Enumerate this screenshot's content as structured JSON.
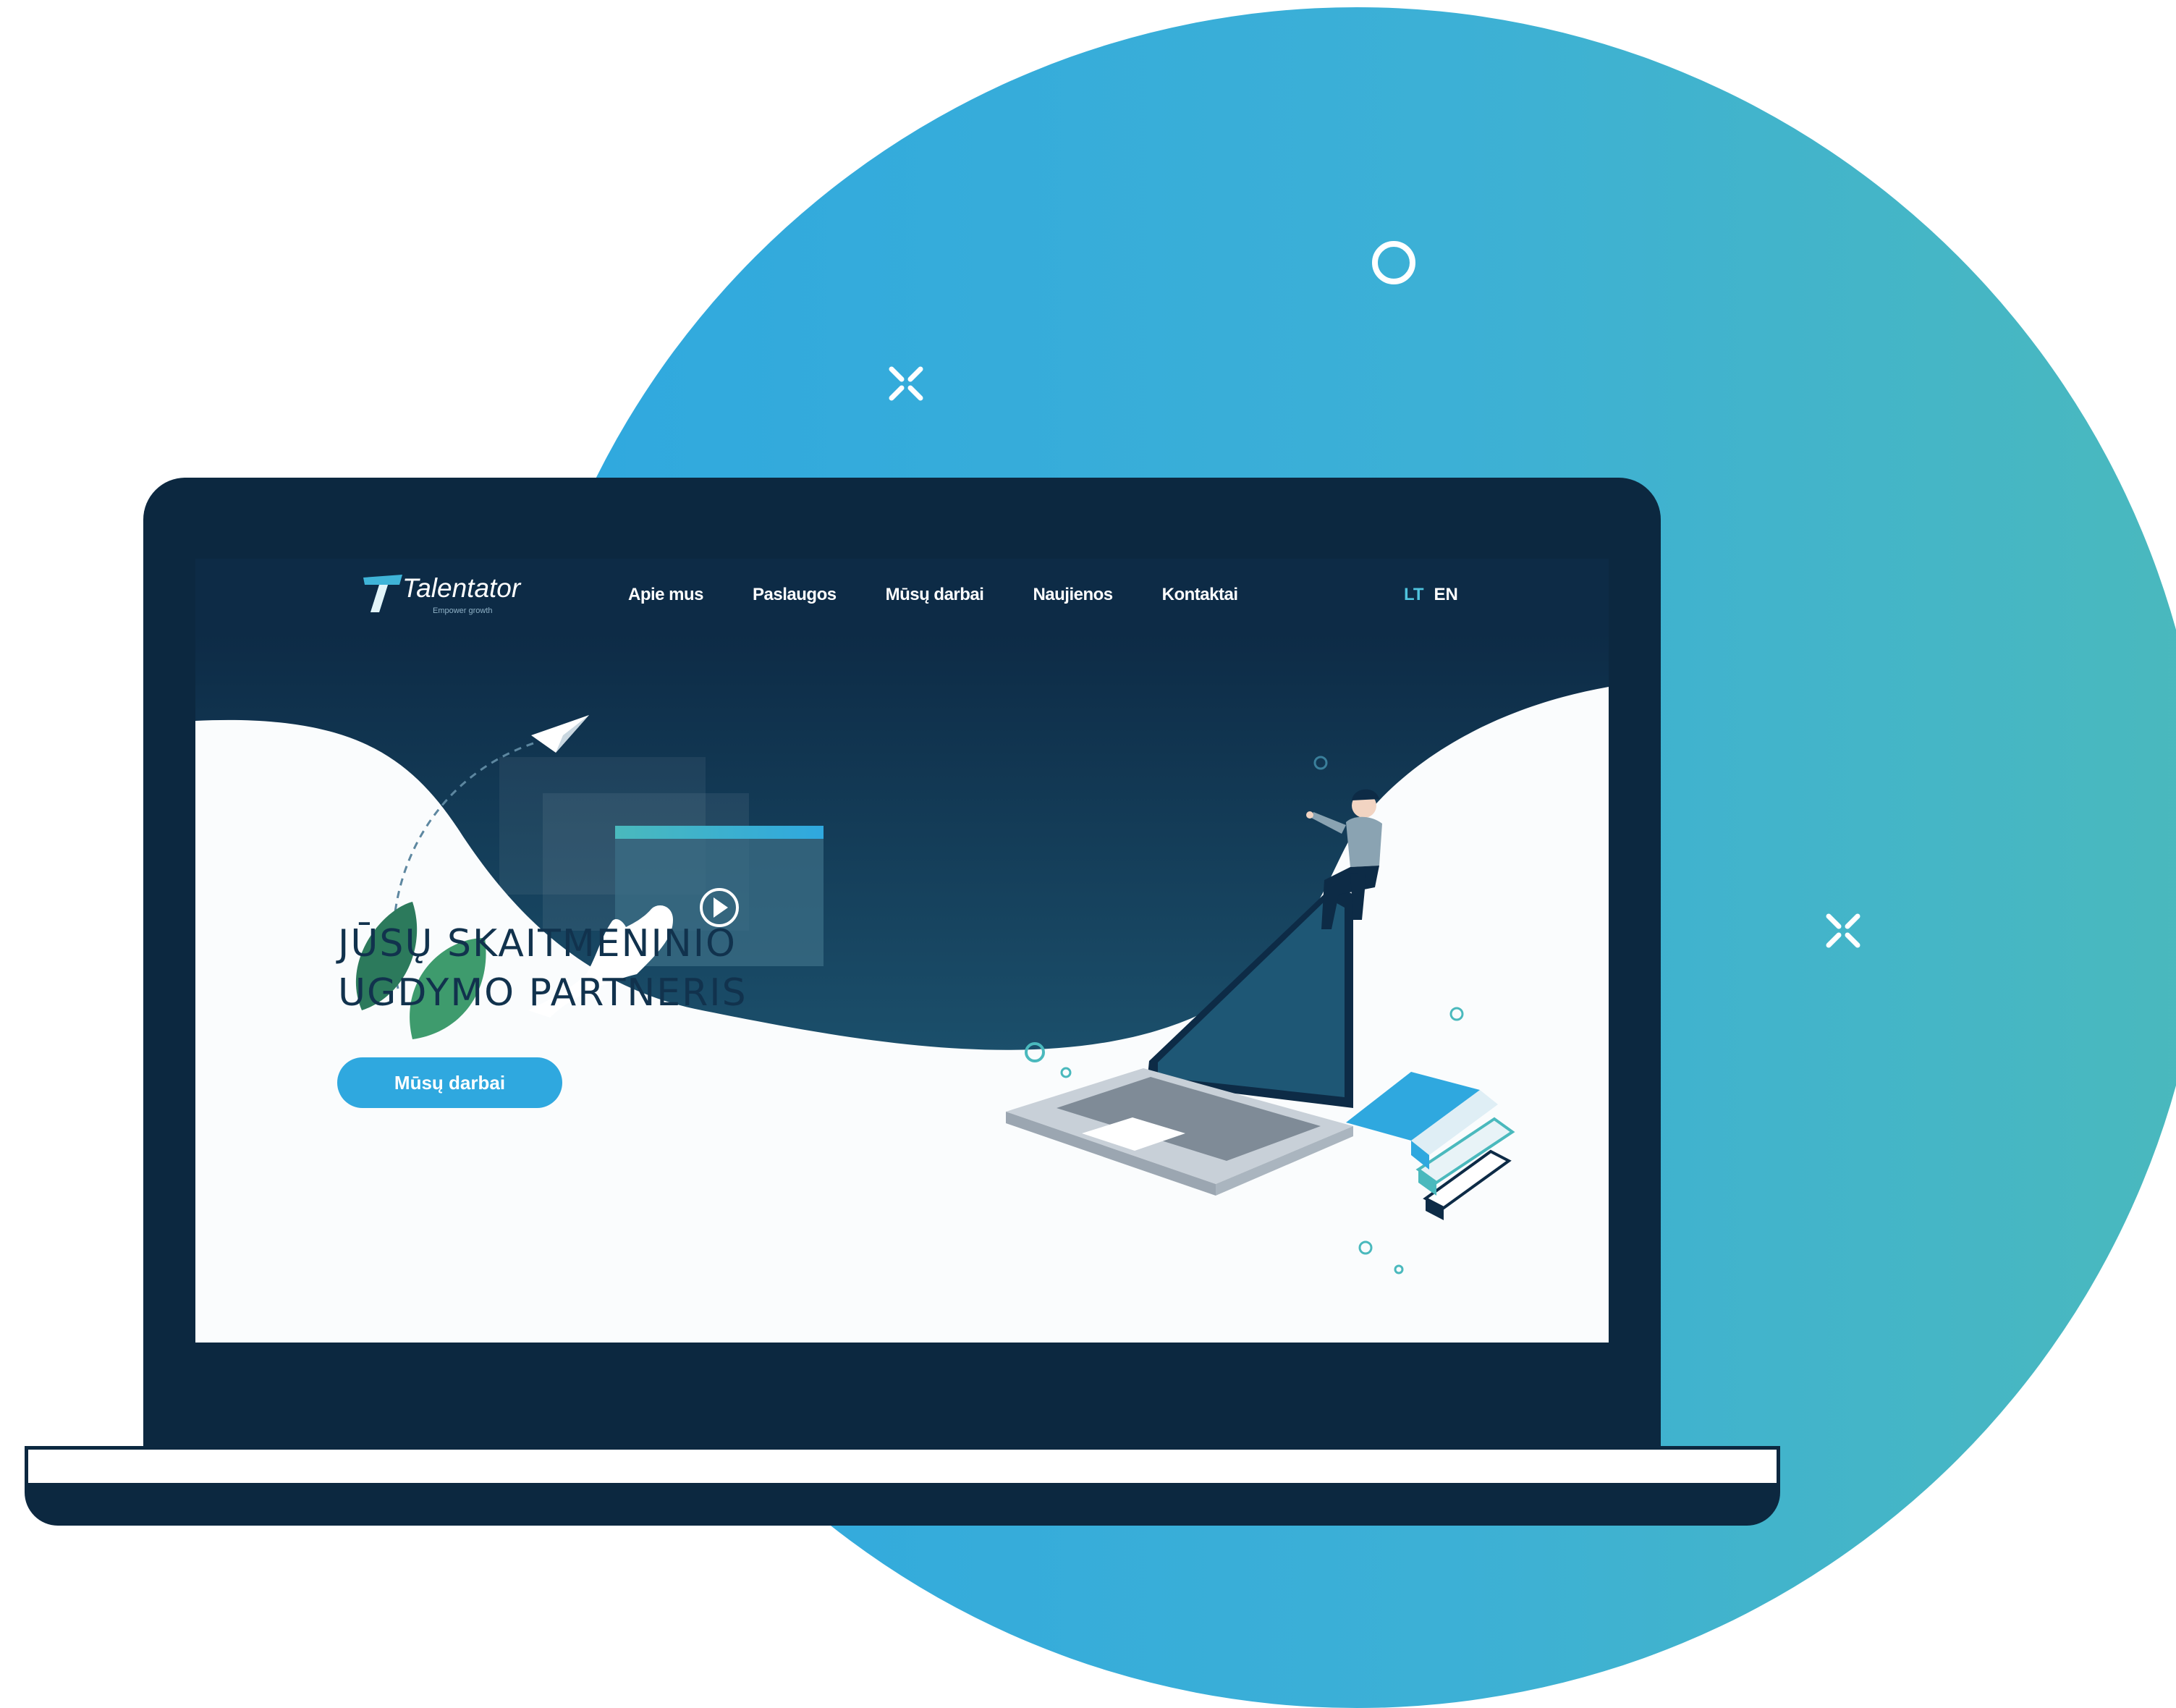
{
  "site": {
    "logo": {
      "name": "Talentator",
      "tagline": "Empower growth"
    },
    "nav": {
      "items": [
        {
          "label": "Apie mus"
        },
        {
          "label": "Paslaugos"
        },
        {
          "label": "Mūsų darbai"
        },
        {
          "label": "Naujienos"
        },
        {
          "label": "Kontaktai"
        }
      ],
      "languages": [
        {
          "code": "LT",
          "active": true
        },
        {
          "code": "EN",
          "active": false
        }
      ]
    },
    "hero": {
      "title_line1": "JŪSŲ SKAITMENINIO",
      "title_line2": "UGDYMO PARTNERIS",
      "cta_label": "Mūsų darbai"
    }
  },
  "colors": {
    "laptop_frame": "#0c2840",
    "nav_background": "#0d2b46",
    "accent": "#2fa8df",
    "lang_active": "#4fc3dd",
    "title_text": "#11324d",
    "circle_gradient_start": "#2fa8df",
    "circle_gradient_end": "#4ab9bd"
  },
  "icons": [
    "paper-plane-icon",
    "play-icon",
    "sparkle-icon",
    "ring-icon",
    "leaf-icon",
    "book-stack-icon",
    "laptop-illustration",
    "person-illustration",
    "hand-illustration"
  ]
}
